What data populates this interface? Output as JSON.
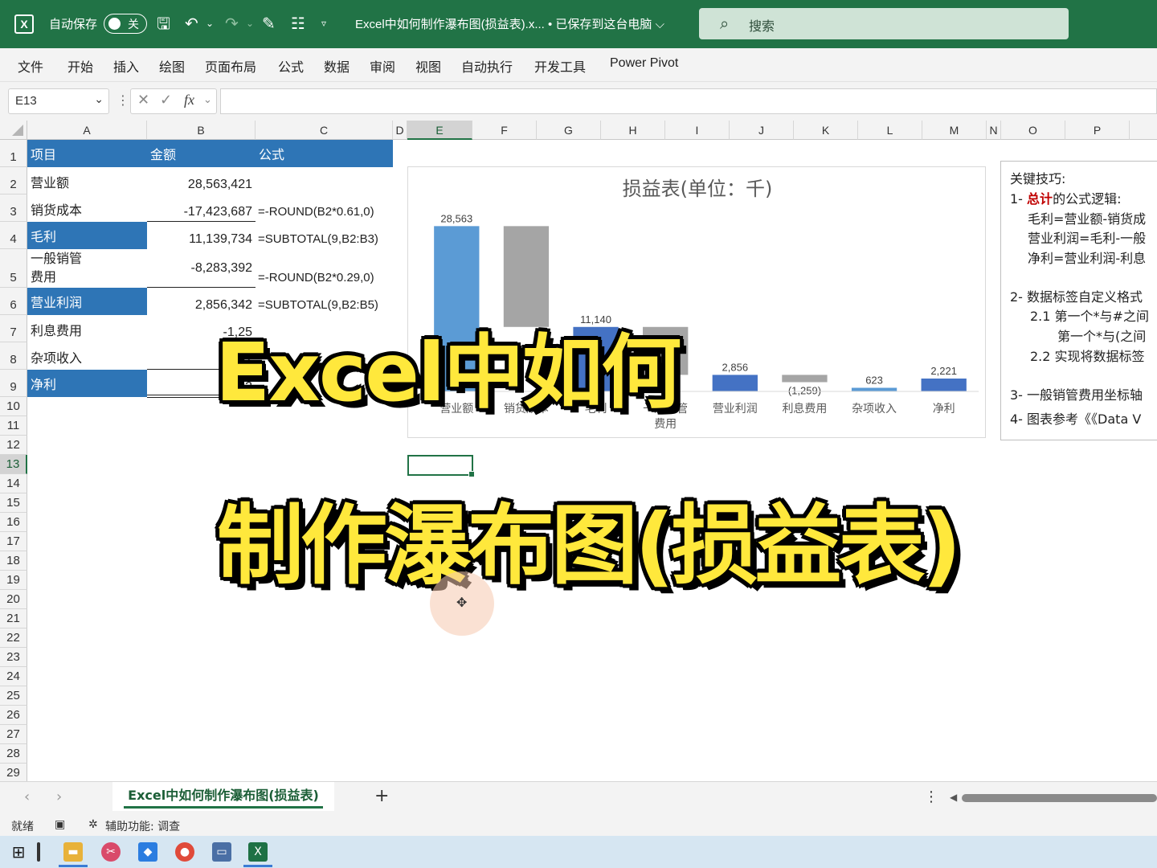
{
  "titlebar": {
    "autosave_label": "自动保存",
    "autosave_state": "关",
    "doc_title": "Excel中如何制作瀑布图(损益表).x... • 已保存到这台电脑 ⌵",
    "search_placeholder": "搜索",
    "icons": [
      "excel-logo-icon",
      "save-icon",
      "undo-icon",
      "redo-icon",
      "format-painter-icon",
      "form-icon",
      "customize-qat-icon",
      "search-icon"
    ]
  },
  "ribbon_tabs": [
    "文件",
    "开始",
    "插入",
    "绘图",
    "页面布局",
    "公式",
    "数据",
    "审阅",
    "视图",
    "自动执行",
    "开发工具",
    "Power Pivot"
  ],
  "formula_bar": {
    "name_box": "E13",
    "fx": "fx",
    "formula": ""
  },
  "columns": [
    "A",
    "B",
    "C",
    "D",
    "E",
    "F",
    "G",
    "H",
    "I",
    "J",
    "K",
    "L",
    "M",
    "N",
    "O",
    "P"
  ],
  "rows": [
    "1",
    "2",
    "3",
    "4",
    "5",
    "6",
    "7",
    "8",
    "9",
    "10",
    "11",
    "12",
    "13",
    "14",
    "15",
    "16",
    "17",
    "18",
    "19",
    "20",
    "21",
    "22",
    "23",
    "24",
    "25",
    "26",
    "27",
    "28",
    "29"
  ],
  "table": {
    "header": [
      "项目",
      "金额",
      "公式"
    ],
    "rows": [
      {
        "item": "营业额",
        "amount": "28,563,421",
        "formula": ""
      },
      {
        "item": "销货成本",
        "amount": "-17,423,687",
        "formula": "=-ROUND(B2*0.61,0)"
      },
      {
        "item": "毛利",
        "amount": "11,139,734",
        "formula": "=SUBTOTAL(9,B2:B3)"
      },
      {
        "item": "一般销管\n费用",
        "amount": "-8,283,392",
        "formula": "=-ROUND(B2*0.29,0)"
      },
      {
        "item": "营业利润",
        "amount": "2,856,342",
        "formula": "=SUBTOTAL(9,B2:B5)"
      },
      {
        "item": "利息费用",
        "amount": "-1,25",
        "formula": ""
      },
      {
        "item": "杂项收入",
        "amount": "62",
        "formula": ""
      },
      {
        "item": "净利",
        "amount": "2,22",
        "formula": ""
      }
    ]
  },
  "chart_data": {
    "type": "bar",
    "title": "损益表(单位：千)",
    "categories": [
      "营业额",
      "销货成本",
      "毛利",
      "一般销管费用",
      "营业利润",
      "利息费用",
      "杂项收入",
      "净利"
    ],
    "category_labels": [
      [
        "营业额"
      ],
      [
        "销货成本"
      ],
      [
        "毛利"
      ],
      [
        "一般销管",
        "费用"
      ],
      [
        "营业利润"
      ],
      [
        "利息费用"
      ],
      [
        "杂项收入"
      ],
      [
        "净利"
      ]
    ],
    "values": [
      28563,
      -17424,
      11140,
      -8283,
      2856,
      -1259,
      623,
      2221
    ],
    "data_labels": [
      "28,563",
      "",
      "11,140",
      "",
      "2,856",
      "(1,259)",
      "623",
      "2,221"
    ],
    "colors": [
      "#5b9bd5",
      "#a5a5a5",
      "#4472c4",
      "#a5a5a5",
      "#4472c4",
      "#a5a5a5",
      "#5b9bd5",
      "#4472c4"
    ],
    "ylim": [
      0,
      30000
    ],
    "grid": false,
    "legend": "none"
  },
  "notes": {
    "title": "关键技巧:",
    "lines": [
      {
        "prefix": "1- ",
        "red": "总计",
        "text": "的公式逻辑:"
      },
      {
        "prefix": "",
        "red": "",
        "text": "毛利=营业额-销货成"
      },
      {
        "prefix": "",
        "red": "",
        "text": "营业利润=毛利-一般"
      },
      {
        "prefix": "",
        "red": "",
        "text": "净利=营业利润-利息"
      },
      {
        "prefix": "2- ",
        "red": "",
        "text": "数据标签自定义格式"
      },
      {
        "prefix": "2.1 ",
        "red": "",
        "text": "第一个*与#之间"
      },
      {
        "prefix": "",
        "red": "",
        "text": "第一个*与(之间"
      },
      {
        "prefix": "2.2 ",
        "red": "",
        "text": "实现将数据标签"
      },
      {
        "prefix": "3- ",
        "red": "",
        "text": "一般销管费用坐标轴"
      },
      {
        "prefix": "4- ",
        "red": "",
        "text": "图表参考《《Data V"
      }
    ]
  },
  "overlay": {
    "line1": "Excel中如何",
    "line2": "制作瀑布图(损益表)"
  },
  "sheet_tab": "Excel中如何制作瀑布图(损益表)",
  "statusbar": {
    "ready": "就绪",
    "accessibility": "辅助功能: 调查"
  },
  "taskbar_icons": [
    "windows-start-icon",
    "file-explorer-icon",
    "snipping-tool-icon",
    "vpn-icon",
    "chrome-icon",
    "window-app-icon",
    "excel-taskbar-icon"
  ]
}
